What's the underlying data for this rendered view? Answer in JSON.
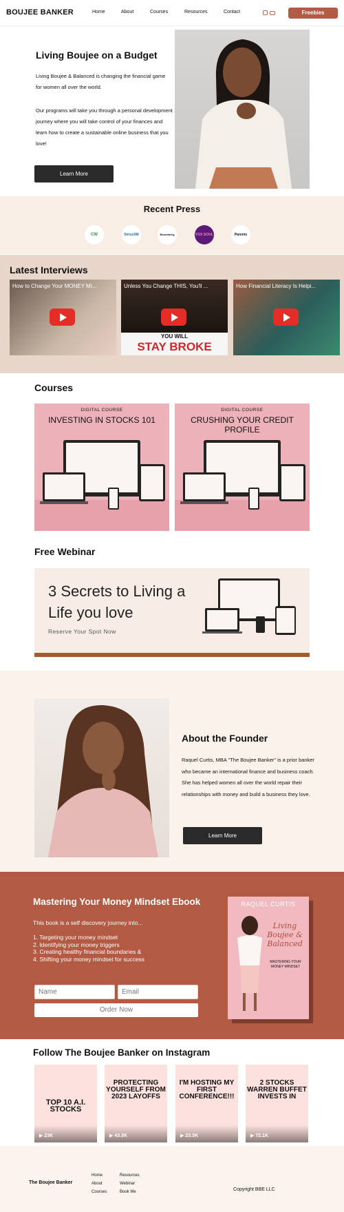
{
  "header": {
    "logo": "BOUJEE BANKER",
    "nav": [
      "Home",
      "About",
      "Courses",
      "Resources",
      "Contact"
    ],
    "freebies_label": "Freebies"
  },
  "hero": {
    "title": "Living Boujee on a Budget",
    "paragraph1": "Living Boujee & Balanced is changing the financial game for women all over the world.",
    "paragraph2": "Our programs will take you through a personal development journey where you will take control of your finances and learn how to create a sustainable online business that you love!",
    "button": "Learn More"
  },
  "press": {
    "title": "Recent Press",
    "logos": [
      "CW",
      "SiriusXM",
      "Bloomberg",
      "FOX SOUL",
      "Parents"
    ]
  },
  "interviews": {
    "title": "Latest Interviews",
    "videos": [
      {
        "title": "How to Change Your MONEY MI..."
      },
      {
        "title": "Unless You Change THIS, You'll ..."
      },
      {
        "title": "How Financial Literacy Is Helpi..."
      }
    ]
  },
  "courses": {
    "title": "Courses",
    "items": [
      {
        "tag": "DIGITAL COURSE",
        "name": "INVESTING IN STOCKS 101"
      },
      {
        "tag": "DIGITAL COURSE",
        "name": "CRUSHING YOUR CREDIT PROFILE"
      }
    ]
  },
  "webinar": {
    "title": "Free Webinar",
    "headline": "3 Secrets to Living a Life you love",
    "cta": "Reserve Your Spot Now"
  },
  "founder": {
    "title": "About the Founder",
    "bio": "Raquel Curtis, MBA \"The Boujee Banker\" is a prior banker who became an international finance and business coach. She has helped women all over the world repair their relationships with money and build a business they love.",
    "button": "Learn More"
  },
  "ebook": {
    "title": "Mastering Your Money Mindset Ebook",
    "intro": "This book is a self discovery journey into...",
    "list": [
      "1. Targeting your money mindset",
      "2. Identifying your money triggers",
      "3. Creating healthy financial boundaries &",
      "4. Shifting your money mindset for success"
    ],
    "name_placeholder": "Name",
    "email_placeholder": "Email",
    "order_label": "Order Now",
    "book_author": "RAQUEL CURTIS",
    "book_title": "Living Boujee & Balanced",
    "book_subtitle": "MASTERING YOUR MONEY MINDSET"
  },
  "instagram": {
    "title": "Follow The Boujee Banker on Instagram",
    "posts": [
      {
        "headline": "TOP 10 A.I. STOCKS",
        "views": "23K"
      },
      {
        "headline": "PROTECTING YOURSELF FROM 2023 LAYOFFS",
        "views": "43.3K"
      },
      {
        "headline": "I'M HOSTING MY FIRST CONFERENCE!!!",
        "views": "23.3K"
      },
      {
        "headline": "2 STOCKS WARREN BUFFET INVESTS IN",
        "views": "72.1K"
      }
    ]
  },
  "footer": {
    "brand": "The Boujee Banker",
    "col1": [
      "Home",
      "About",
      "Courses"
    ],
    "col2": [
      "Resources",
      "Webinar",
      "Book Me"
    ],
    "copyright": "Copyright BBE LLC"
  }
}
